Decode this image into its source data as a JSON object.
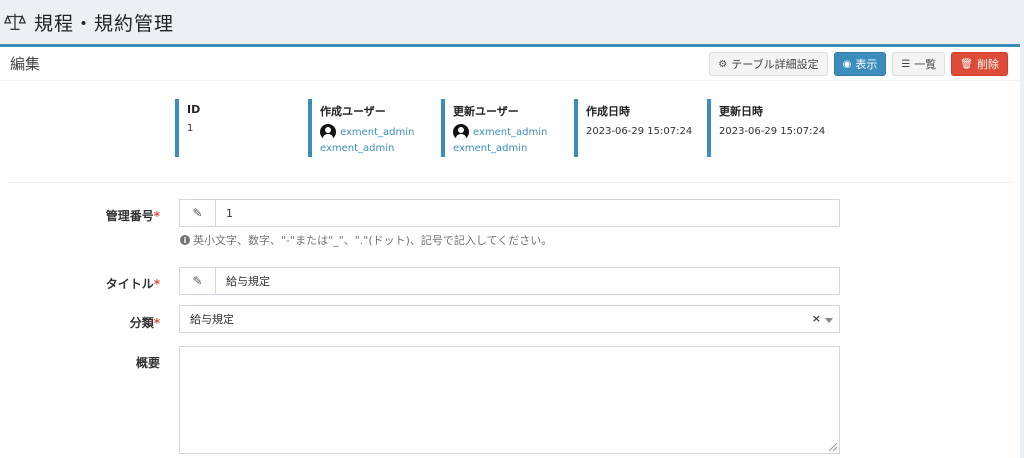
{
  "header": {
    "title": "規程・規約管理",
    "icon": "scale-icon"
  },
  "box": {
    "title": "編集",
    "buttons": {
      "table_settings": "テーブル詳細設定",
      "view": "表示",
      "list": "一覧",
      "delete": "削除"
    }
  },
  "info": {
    "id_label": "ID",
    "id_value": "1",
    "created_by_label": "作成ユーザー",
    "created_by_user": "exment_admin",
    "created_by_user2": "exment_admin",
    "updated_by_label": "更新ユーザー",
    "updated_by_user": "exment_admin",
    "updated_by_user2": "exment_admin",
    "created_at_label": "作成日時",
    "created_at_value": "2023-06-29 15:07:24",
    "updated_at_label": "更新日時",
    "updated_at_value": "2023-06-29 15:07:24"
  },
  "form": {
    "number_label": "管理番号",
    "number_value": "1",
    "number_help": "英小文字、数字、\"-\"または\"_\"、\".\"(ドット)、記号で記入してください。",
    "title_label": "タイトル",
    "title_value": "給与規定",
    "category_label": "分類",
    "category_value": "給与規定",
    "summary_label": "概要",
    "required_mark": "*"
  },
  "colors": {
    "accent": "#3c8dbc",
    "danger": "#dd4b39"
  }
}
